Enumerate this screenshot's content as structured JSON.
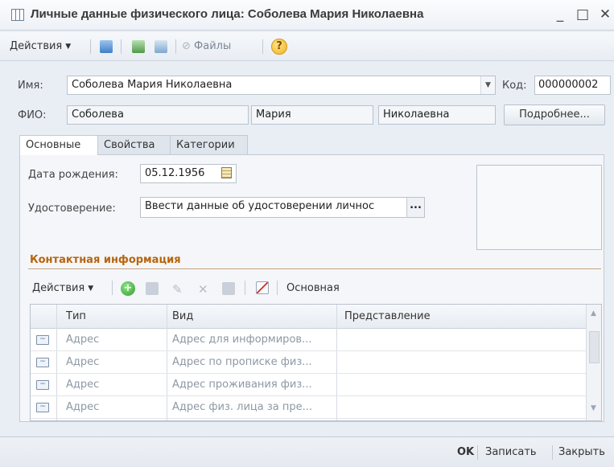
{
  "window": {
    "title": "Личные данные физического лица: Соболева Мария Николаевна",
    "minimize": "_",
    "maximize": "□",
    "close": "✕"
  },
  "toolbar": {
    "actions": "Действия",
    "files": "Файлы",
    "help": "?"
  },
  "form": {
    "name_label": "Имя:",
    "name_value": "Соболева Мария Николаевна",
    "code_label": "Код:",
    "code_value": "000000002",
    "fio_label": "ФИО:",
    "last_name": "Соболева",
    "first_name": "Мария",
    "middle_name": "Николаевна",
    "details_button": "Подробнее..."
  },
  "tabs": [
    {
      "label": "Основные",
      "active": true
    },
    {
      "label": "Свойства",
      "active": false
    },
    {
      "label": "Категории",
      "active": false
    }
  ],
  "main_tab": {
    "birth_label": "Дата рождения:",
    "birth_value": "05.12.1956",
    "id_label": "Удостоверение:",
    "id_value": "Ввести данные об удостоверении личнос",
    "id_button": "..."
  },
  "contacts": {
    "title": "Контактная информация",
    "toolbar_actions": "Действия",
    "toolbar_primary": "Основная",
    "columns": [
      "Тип",
      "Вид",
      "Представление"
    ],
    "rows": [
      {
        "type": "Адрес",
        "kind": "Адрес для информиров...",
        "repr": ""
      },
      {
        "type": "Адрес",
        "kind": "Адрес по прописке физ...",
        "repr": ""
      },
      {
        "type": "Адрес",
        "kind": "Адрес проживания физ...",
        "repr": ""
      },
      {
        "type": "Адрес",
        "kind": "Адрес физ. лица за пре...",
        "repr": ""
      }
    ]
  },
  "footer": {
    "ok": "OK",
    "save": "Записать",
    "close": "Закрыть"
  }
}
